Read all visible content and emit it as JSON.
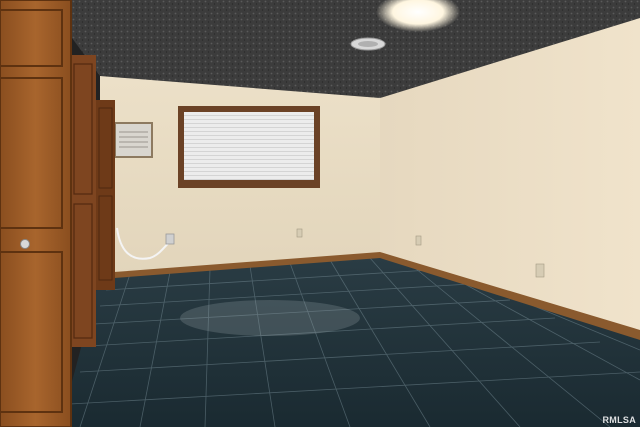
{
  "photo": {
    "watermark": "RMLSA"
  },
  "colors": {
    "ceiling": "#3a3a3a",
    "wall_back": "#e9dcc4",
    "wall_right": "#eddfc6",
    "floor_tile": "#1f3038",
    "baseboard": "#8a5a2e",
    "door_wood": "#9a5a26",
    "window_frame": "#6b4226",
    "blinds": "#e6e6e6"
  }
}
